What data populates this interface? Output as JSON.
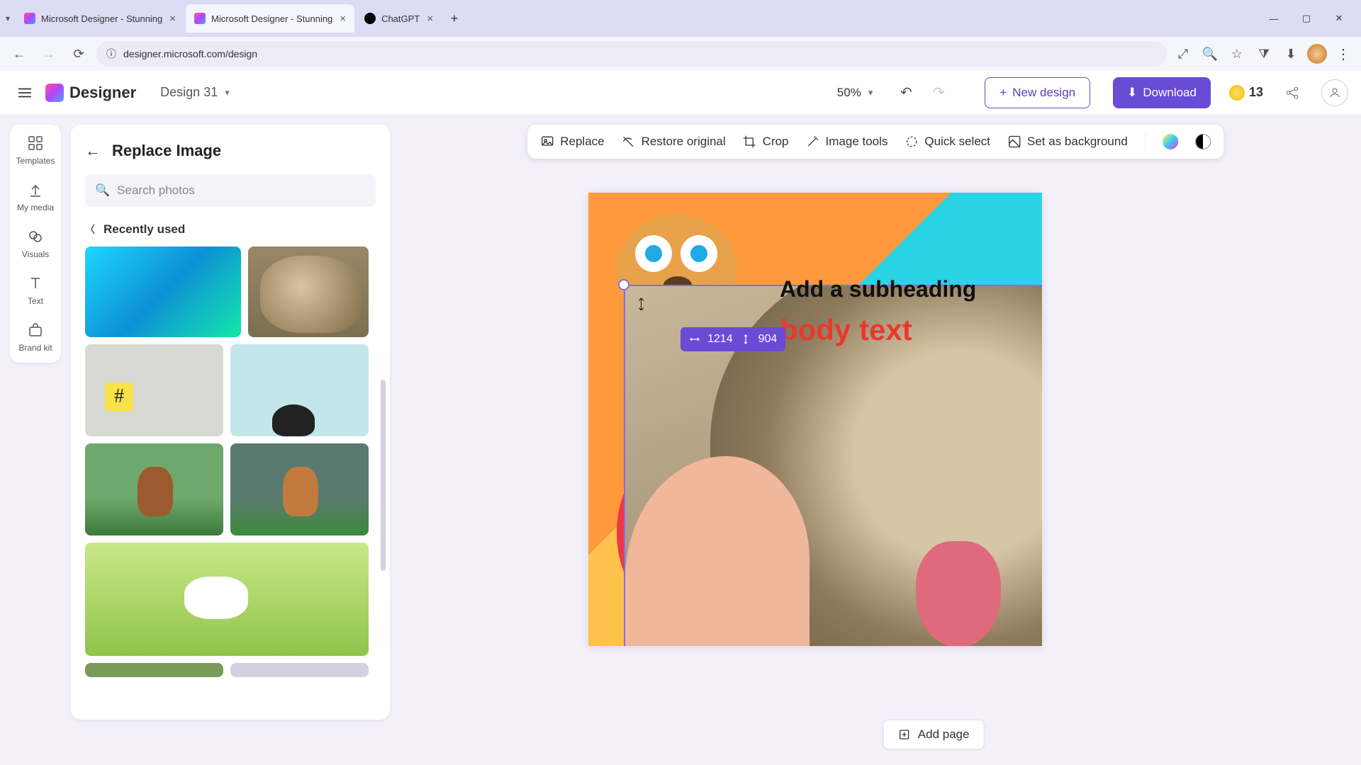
{
  "browser": {
    "tabs": [
      {
        "title": "Microsoft Designer - Stunning",
        "active": false
      },
      {
        "title": "Microsoft Designer - Stunning",
        "active": true
      },
      {
        "title": "ChatGPT",
        "active": false,
        "icon": "gpt"
      }
    ],
    "url": "designer.microsoft.com/design"
  },
  "header": {
    "logo_text": "Designer",
    "design_name": "Design 31",
    "zoom": "50%",
    "new_design": "New design",
    "download": "Download",
    "credits": "13"
  },
  "rail": {
    "items": [
      {
        "label": "Templates"
      },
      {
        "label": "My media"
      },
      {
        "label": "Visuals"
      },
      {
        "label": "Text"
      },
      {
        "label": "Brand kit"
      }
    ]
  },
  "panel": {
    "title": "Replace Image",
    "search_placeholder": "Search photos",
    "section": "Recently used"
  },
  "ctx_toolbar": {
    "replace": "Replace",
    "restore": "Restore original",
    "crop": "Crop",
    "image_tools": "Image tools",
    "quick_select": "Quick select",
    "set_bg": "Set as background"
  },
  "canvas": {
    "subheading": "Add a subheading",
    "body_text": "body text",
    "dim_w": "1214",
    "dim_h": "904",
    "add_page": "Add page"
  }
}
